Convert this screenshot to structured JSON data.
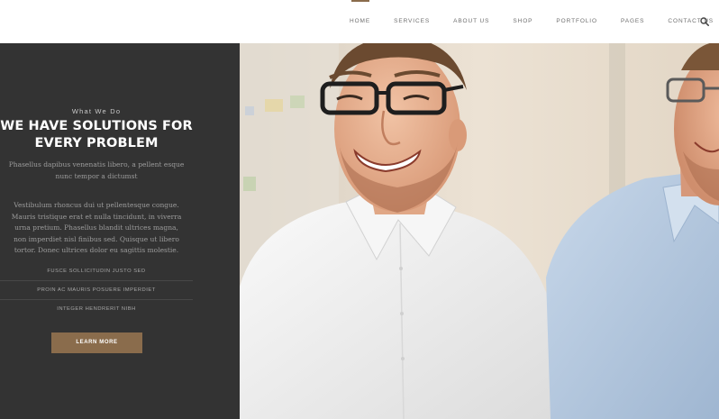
{
  "nav": {
    "items": [
      {
        "label": "HOME",
        "active": true
      },
      {
        "label": "SERVICES",
        "active": false
      },
      {
        "label": "ABOUT US",
        "active": false
      },
      {
        "label": "SHOP",
        "active": false
      },
      {
        "label": "PORTFOLIO",
        "active": false
      },
      {
        "label": "PAGES",
        "active": false
      },
      {
        "label": "CONTACT US",
        "active": false
      }
    ],
    "search_icon": "search-icon",
    "active_color": "#8a6c4c"
  },
  "hero": {
    "eyebrow": "What We Do",
    "headline_line1": "WE HAVE SOLUTIONS FOR",
    "headline_line2": "EVERY PROBLEM",
    "subtext": "Phasellus dapibus venenatis libero, a pellent esque nunc tempor a dictumst",
    "body": "Vestibulum rhoncus dui ut pellentesque congue. Mauris tristique erat et nulla tincidunt, in viverra urna pretium. Phasellus blandit ultrices magna, non imperdiet nisl finibus sed. Quisque ut libero tortor. Donec ultrices dolor eu sagittis molestie.",
    "features": [
      "FUSCE SOLLICITUDIN JUSTO SED",
      "PROIN AC MAURIS POSUERE IMPERDIET",
      "INTEGER HENDRERIT NIBH"
    ],
    "button_label": "LEARN MORE",
    "panel_color": "#333333",
    "accent_color": "#8a6c4c"
  }
}
